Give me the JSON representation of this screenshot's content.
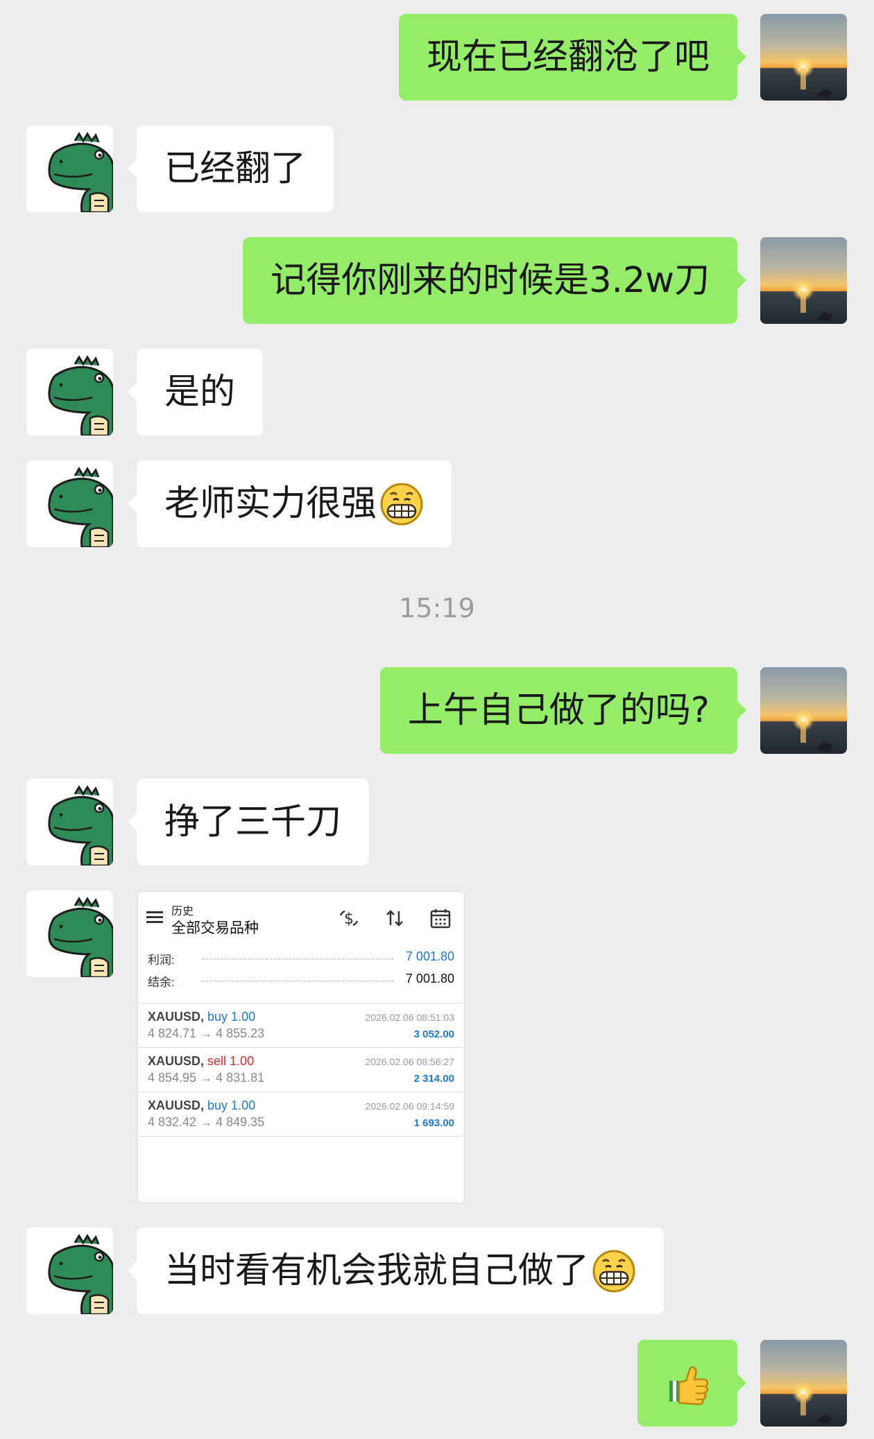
{
  "messages": [
    {
      "direction": "out",
      "text": "现在已经翻沧了吧"
    },
    {
      "direction": "in",
      "text": "已经翻了"
    },
    {
      "direction": "out",
      "text": "记得你刚来的时候是3.2w刀"
    },
    {
      "direction": "in",
      "text": "是的"
    },
    {
      "direction": "in",
      "text": "老师实力很强",
      "emoji": "grinning-face"
    },
    {
      "direction": "out",
      "text": "上午自己做了的吗?"
    },
    {
      "direction": "in",
      "text": "挣了三千刀"
    },
    {
      "direction": "in",
      "type": "image"
    },
    {
      "direction": "in",
      "text": "当时看有机会我就自己做了",
      "emoji": "grinning-face"
    },
    {
      "direction": "out",
      "emoji": "thumbs-up"
    }
  ],
  "timestamp": "15:19",
  "history_screenshot": {
    "header_small": "历史",
    "header_title": "全部交易品种",
    "icons": [
      "menu-icon",
      "dollar-swap-icon",
      "sort-icon",
      "calendar-icon"
    ],
    "profit_label": "利润:",
    "profit_value": "7 001.80",
    "balance_label": "结余:",
    "balance_value": "7 001.80",
    "trades": [
      {
        "symbol": "XAUUSD,",
        "side": "buy 1.00",
        "side_color": "#1e78d2",
        "prices": "4 824.71 → 4 855.23",
        "time": "2026.02.06 08:51:03",
        "profit": "3 052.00"
      },
      {
        "symbol": "XAUUSD,",
        "side": "sell 1.00",
        "side_color": "#d32f2f",
        "prices": "4 854.95 → 4 831.81",
        "time": "2026.02.06 08:56:27",
        "profit": "2 314.00"
      },
      {
        "symbol": "XAUUSD,",
        "side": "buy 1.00",
        "side_color": "#1e78d2",
        "prices": "4 832.42 → 4 849.35",
        "time": "2026.02.06 09:14:59",
        "profit": "1 693.00"
      }
    ]
  },
  "colors": {
    "background": "#ededed",
    "outgoing_bubble": "#95ec69",
    "incoming_bubble": "#ffffff",
    "profit_blue": "#1e78d2",
    "timestamp_grey": "#9b9b9b"
  }
}
